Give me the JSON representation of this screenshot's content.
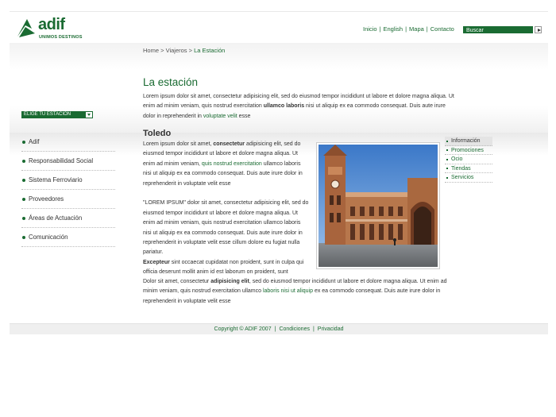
{
  "brand": {
    "name": "adif",
    "tagline": "UNIMOS DESTINOS",
    "color": "#1a6b32"
  },
  "top_nav": {
    "items": [
      "Inicio",
      "English",
      "Mapa",
      "Contacto"
    ],
    "separator": "|"
  },
  "search": {
    "value": "Buscar"
  },
  "breadcrumb": {
    "home": "Home",
    "sep1": " > ",
    "section": "Viajeros",
    "sep2": " > ",
    "current": "La Estación"
  },
  "page": {
    "title": "La estación",
    "intro": {
      "part1": "Lorem ipsum dolor sit amet, consectetur adipisicing elit, sed do eiusmod tempor incididunt ut labore et dolore magna aliqua. Ut enim ad minim veniam, quis nostrud exercitation ",
      "bold": "ullamco laboris",
      "part2": " nisi ut aliquip ex ea commodo consequat. Duis aute irure dolor in reprehenderit in ",
      "link": "voluptate velit",
      "part3": " esse"
    }
  },
  "station_select": {
    "value": "ELIGE TU ESTACIÓN"
  },
  "side_nav": {
    "items": [
      "Adif",
      "Responsabilidad Social",
      "Sistema Ferroviario",
      "Proveedores",
      "Áreas de Actuación",
      "Comunicación"
    ]
  },
  "content": {
    "section_title": "Toledo",
    "p1": {
      "a": "Lorem ipsum dolor sit amet, ",
      "bold": "consectetur",
      "b": " adipisicing elit, sed do eiusmod tempor incididunt ut labore et dolore magna aliqua. Ut enim ad minim veniam, ",
      "link": "quis nostrud exercitation",
      "c": " ullamco laboris nisi ut aliquip ex ea commodo consequat. Duis aute irure dolor in reprehenderit in voluptate velit esse"
    },
    "p2": "\"LOREM IPSUM\" dolor sit amet, consectetur adipisicing elit, sed do eiusmod tempor incididunt ut labore et dolore magna aliqua. Ut enim ad minim veniam, quis nostrud exercitation ullamco laboris nisi ut aliquip ex ea commodo consequat. Duis aute irure dolor in reprehenderit in voluptate velit esse cillum dolore eu fugiat nulla pariatur.",
    "p3": {
      "bold": "Excepteur",
      "a": " sint occaecat cupidatat non proident, sunt in culpa qui officia deserunt mollit anim id est laborum on proident, sunt"
    },
    "p4": {
      "a": "Dolor sit amet, consectetur ",
      "bold": "adipisicing elit",
      "b": ", sed do eiusmod tempor incididunt ut labore et dolore magna aliqua. Ut enim ad minim veniam, quis nostrud exercitation ullamco ",
      "link": "laboris nisi ut aliquip",
      "c": " ex ea commodo consequat. Duis aute irure dolor in reprehenderit in voluptate velit esse"
    }
  },
  "right_nav": {
    "items": [
      "Información",
      "Promociones",
      "Ocio",
      "Tiendas",
      "Servicios"
    ],
    "active": "Información"
  },
  "footer": {
    "copyright": "Copyright © ADIF 2007",
    "links": [
      "Condiciones",
      "Privacidad"
    ],
    "separator": "|"
  },
  "icons": {
    "logo": "adif-logo-icon",
    "search_go": "arrow-right-icon",
    "select_arrow": "chevron-down-icon",
    "bullet": "bullet-dot-icon"
  }
}
